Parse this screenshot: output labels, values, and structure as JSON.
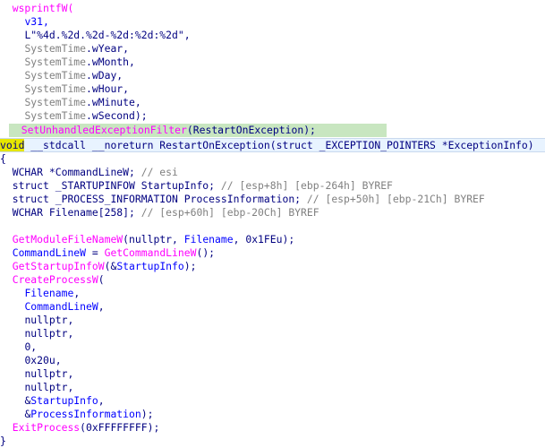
{
  "code": {
    "l1": "wsprintfW(",
    "l2": "v31,",
    "l3": "L\"%4d.%2d.%2d-%2d:%2d:%2d\",",
    "l4a": "SystemTime",
    "l4b": ".wYear,",
    "l5a": "SystemTime",
    "l5b": ".wMonth,",
    "l6a": "SystemTime",
    "l6b": ".wDay,",
    "l7a": "SystemTime",
    "l7b": ".wHour,",
    "l8a": "SystemTime",
    "l8b": ".wMinute,",
    "l9a": "SystemTime",
    "l9b": ".wSecond);",
    "l10a": "SetUnhandledExceptionFilter",
    "l10b": "(",
    "l10c": "RestartOnException",
    "l10d": ");",
    "l11a": "void",
    "l11b": " __stdcall __noreturn RestartOnException(struct _EXCEPTION_POINTERS *ExceptionInfo)",
    "l12": "{",
    "l13a": "WCHAR *CommandLineW; ",
    "l13b": "// esi",
    "l14a": "struct _STARTUPINFOW StartupInfo; ",
    "l14b": "// [esp+8h] [ebp-264h] BYREF",
    "l15a": "struct _PROCESS_INFORMATION ProcessInformation; ",
    "l15b": "// [esp+50h] [ebp-21Ch] BYREF",
    "l16a": "WCHAR Filename[258]; ",
    "l16b": "// [esp+60h] [ebp-20Ch] BYREF",
    "l17a": "GetModuleFileNameW",
    "l17b": "(nullptr, ",
    "l17c": "Filename",
    "l17d": ", 0x1FEu);",
    "l18a": "CommandLineW",
    "l18b": " = ",
    "l18c": "GetCommandLineW",
    "l18d": "();",
    "l19a": "GetStartupInfoW",
    "l19b": "(&",
    "l19c": "StartupInfo",
    "l19d": ");",
    "l20a": "CreateProcessW",
    "l20b": "(",
    "l21": "Filename",
    "l21b": ",",
    "l22": "CommandLineW",
    "l22b": ",",
    "l23": "nullptr,",
    "l24": "nullptr,",
    "l25": "0,",
    "l26": "0x20u,",
    "l27": "nullptr,",
    "l28": "nullptr,",
    "l29a": "&",
    "l29b": "StartupInfo",
    "l29c": ",",
    "l30a": "&",
    "l30b": "ProcessInformation",
    "l30c": ");",
    "l31a": "ExitProcess",
    "l31b": "(0xFFFFFFFF);",
    "l32": "}"
  },
  "colors": {
    "function": "#ff00ff",
    "local_var": "#0000ff",
    "global_var": "#808080",
    "comment": "#808080",
    "text": "#000080",
    "line_highlight": "#c8e6c0",
    "cursor_line": "#e8f3ff"
  }
}
